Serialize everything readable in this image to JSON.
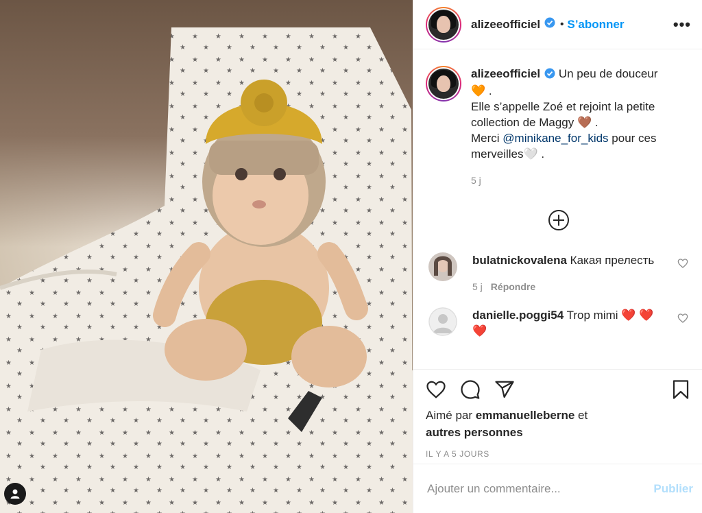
{
  "header": {
    "username": "alizeeofficiel",
    "separator": "•",
    "follow_label": "S’abonner",
    "more_label": "•••"
  },
  "caption": {
    "username": "alizeeofficiel",
    "line1": "Un peu de douceur",
    "line2": "🧡 .",
    "line3": "Elle s’appelle Zoé et rejoint la petite collection de Maggy 🤎 .",
    "line4_prefix": "Merci ",
    "mention": "@minikane_for_kids",
    "line4_suffix": " pour ces merveilles🤍 .",
    "age": "5 j"
  },
  "comments": [
    {
      "username": "bulatnickovalena",
      "text": "Какая прелесть",
      "age": "5 j",
      "reply_label": "Répondre"
    },
    {
      "username": "danielle.poggi54",
      "text": "Trop mimi ❤️ ❤️ ❤️"
    }
  ],
  "likes": {
    "prefix": "Aimé par ",
    "user": "emmanuelleberne",
    "suffix": " et",
    "others": "autres personnes"
  },
  "timestamp": "IL Y A 5 JOURS",
  "add_comment": {
    "placeholder": "Ajouter un commentaire...",
    "publish_label": "Publier"
  },
  "colors": {
    "accent": "#0095f6",
    "verified": "#3897f0",
    "publish_disabled": "#b2dffc",
    "mention": "#00376b"
  },
  "icons": [
    "verified-badge-icon",
    "more-icon",
    "add-circle-icon",
    "heart-icon",
    "comment-icon",
    "share-icon",
    "bookmark-icon",
    "user-tag-icon"
  ]
}
